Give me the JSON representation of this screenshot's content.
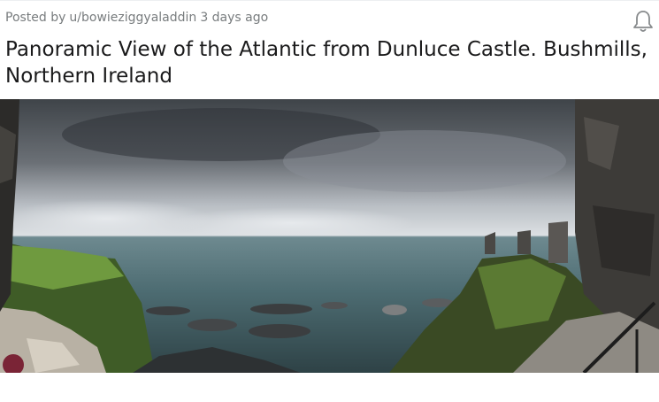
{
  "post": {
    "posted_by_prefix": "Posted by",
    "author": "u/bowieziggyaladdin",
    "time_ago": "3 days ago",
    "title": "Panoramic View of the Atlantic from Dunluce Castle. Bushmills, Northern Ireland",
    "notification_icon": "bell-icon",
    "image_subject": "landscape-photo"
  },
  "colors": {
    "meta_text": "#787c7e",
    "title_text": "#1a1a1b",
    "sky_dark": "#4f5459",
    "sky_light": "#d8dce1",
    "sea": "#4b6a70",
    "grass": "#5f8a3a",
    "stone": "#4a4845"
  }
}
